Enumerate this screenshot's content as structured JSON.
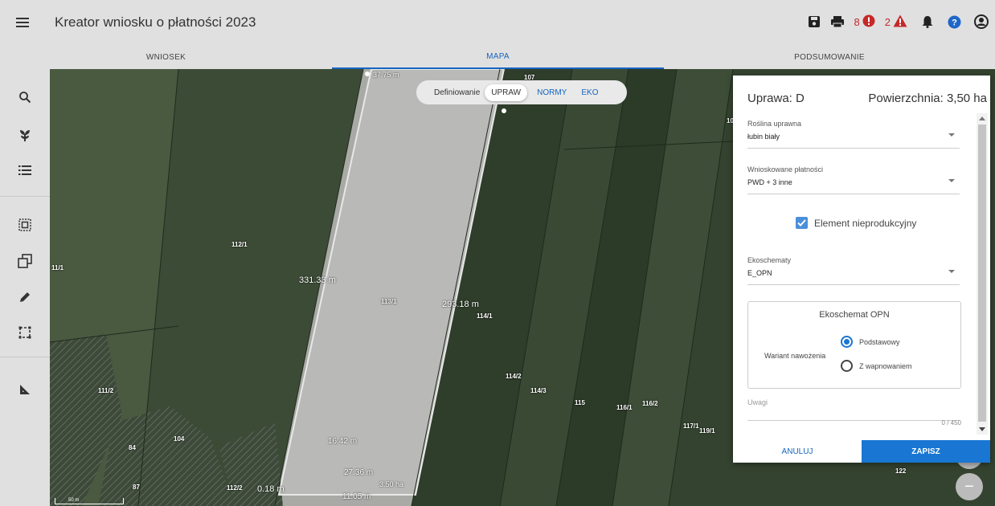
{
  "app": {
    "title": "Kreator wniosku o płatności 2023"
  },
  "topbar": {
    "errors_count": "8",
    "warnings_count": "2",
    "colors": {
      "error": "#c62828",
      "warning": "#c62828",
      "help": "#1e66c8",
      "icon": "#222"
    },
    "icons": [
      "save-icon",
      "print-icon",
      "error-icon",
      "warning-icon",
      "bell-icon",
      "help-icon",
      "account-icon"
    ]
  },
  "tabs": [
    {
      "label": "WNIOSEK",
      "active": false
    },
    {
      "label": "MAPA",
      "active": true
    },
    {
      "label": "PODSUMOWANIE",
      "active": false
    }
  ],
  "sidebar": {
    "icons": [
      "search-icon",
      "leaf-icon",
      "list-icon",
      "select-area-icon",
      "copy-icon",
      "edit-icon",
      "crop-icon",
      "measure-icon"
    ]
  },
  "map": {
    "mode_switch": {
      "prefix": "Definiowanie",
      "options": [
        "UPRAW",
        "NORMY",
        "EKO"
      ],
      "active": "UPRAW"
    },
    "parcel_labels": [
      "112/1",
      "11/1",
      "113/1",
      "114/1",
      "114/2",
      "114/3",
      "115",
      "116/1",
      "116/2",
      "117/1",
      "119/1",
      "111/2",
      "84",
      "104",
      "87",
      "112/2",
      "122",
      "107",
      "10"
    ],
    "measure_labels": [
      "331.33 m",
      "293.18 m",
      "37.75 m",
      "0.18 m",
      "16.42 m",
      "27.36 m",
      "11.05 m",
      "3.50 ha"
    ],
    "scale": "50 m"
  },
  "panel": {
    "crop_label": "Uprawa: D",
    "area_label": "Powierzchnia: 3,50 ha",
    "plant": {
      "label": "Roślina uprawna",
      "value": "łubin biały"
    },
    "payments": {
      "label": "Wnioskowane płatności",
      "value": "PWD + 3 inne"
    },
    "nonproductive": {
      "label": "Element nieprodukcyjny",
      "checked": true
    },
    "ecoschemes": {
      "label": "Ekoschematy",
      "value": "E_OPN"
    },
    "opn": {
      "title": "Ekoschemat OPN",
      "variant_label": "Wariant nawożenia",
      "options": [
        {
          "label": "Podstawowy",
          "selected": true
        },
        {
          "label": "Z wapnowaniem",
          "selected": false
        }
      ]
    },
    "notes": {
      "label": "Uwagi",
      "counter": "0 / 450"
    },
    "cancel_label": "ANULUJ",
    "save_label": "ZAPISZ",
    "accent": "#1976d2"
  }
}
